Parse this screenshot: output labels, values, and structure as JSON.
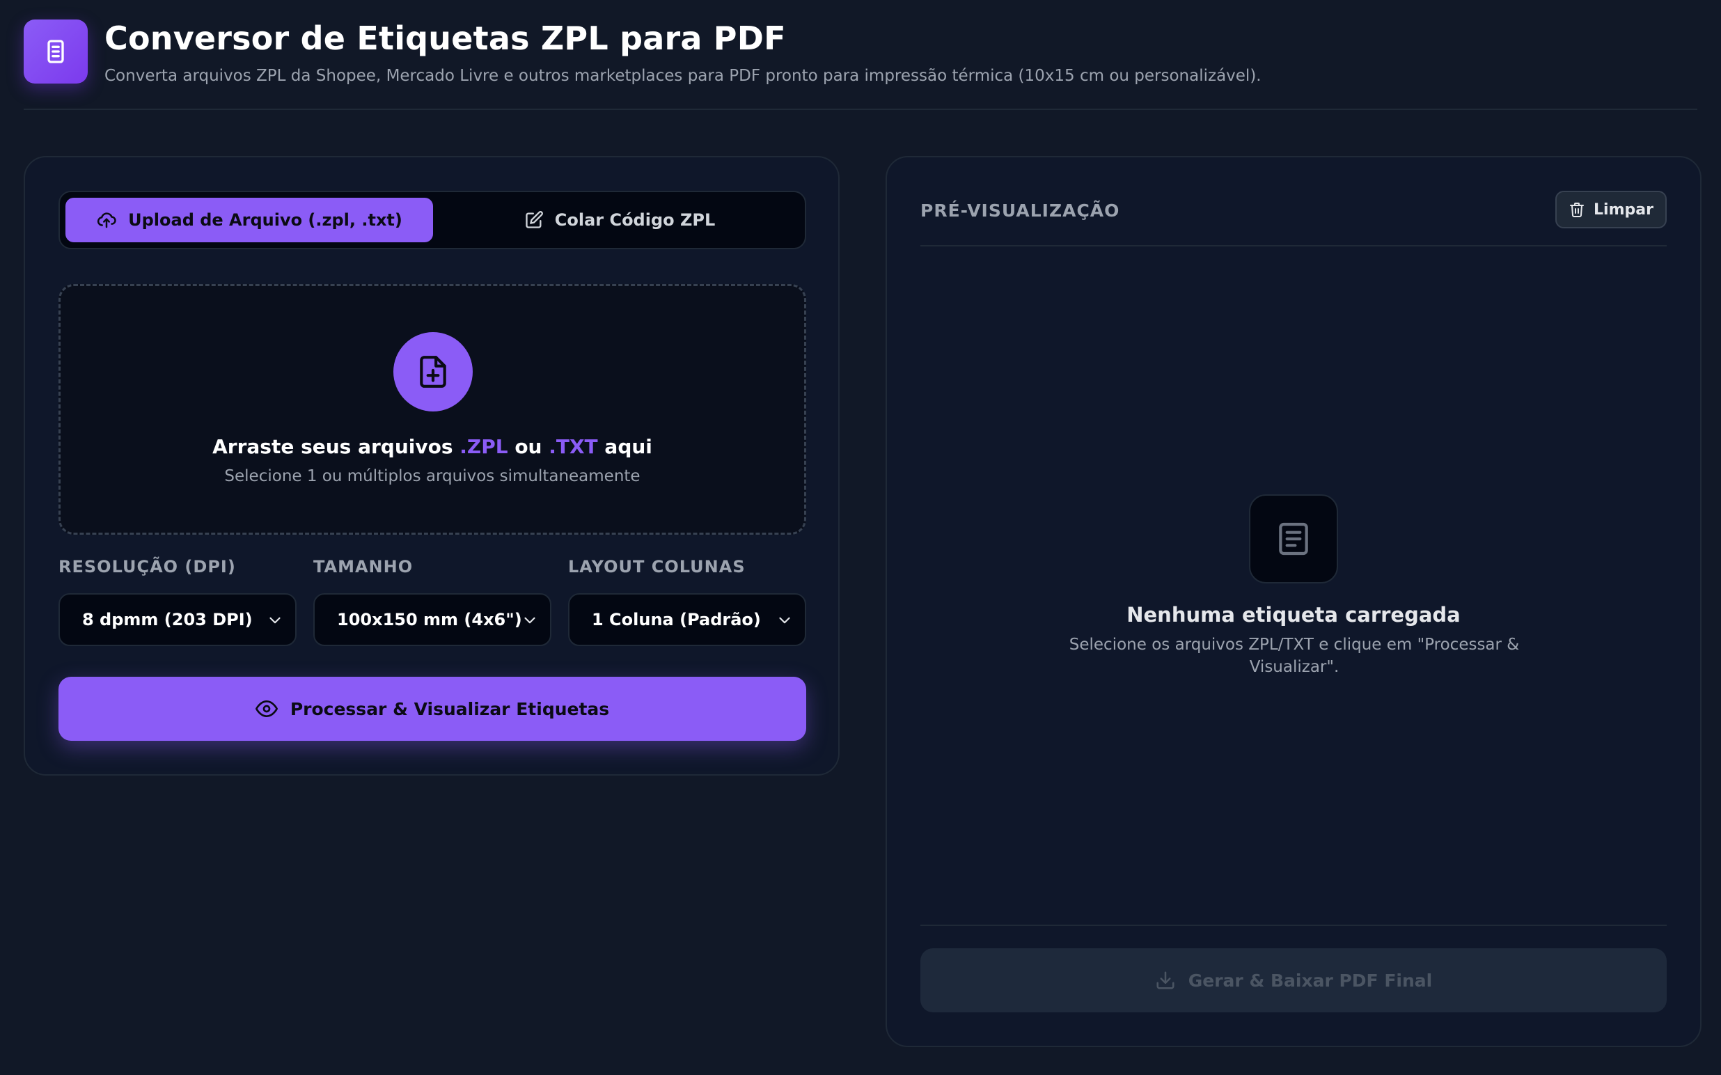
{
  "header": {
    "logo_icon": "document-icon",
    "title": "Conversor de Etiquetas ZPL para PDF",
    "subtitle": "Converta arquivos ZPL da Shopee, Mercado Livre e outros marketplaces para PDF pronto para impressão térmica (10x15 cm ou personalizável)."
  },
  "input_panel": {
    "tabs": [
      {
        "label": "Upload de Arquivo (.zpl, .txt)",
        "icon": "cloud-upload-icon",
        "active": true
      },
      {
        "label": "Colar Código ZPL",
        "icon": "edit-icon",
        "active": false
      }
    ],
    "dropzone": {
      "icon": "file-plus-icon",
      "title_prefix": "Arraste seus arquivos",
      "title_ext1": ".ZPL",
      "title_mid": "ou",
      "title_ext2": ".TXT",
      "title_suffix": "aqui",
      "subtitle": "Selecione 1 ou múltiplos arquivos simultaneamente"
    },
    "settings": {
      "resolution": {
        "label": "RESOLUÇÃO (DPI)",
        "value": "8 dpmm (203 DPI)"
      },
      "size": {
        "label": "TAMANHO",
        "value": "100x150 mm (4x6\")"
      },
      "layout": {
        "label": "LAYOUT COLUNAS",
        "value": "1 Coluna (Padrão)"
      }
    },
    "process_button": "Processar & Visualizar Etiquetas"
  },
  "preview_panel": {
    "title": "PRÉ-VISUALIZAÇÃO",
    "clear_button": "Limpar",
    "empty": {
      "icon": "document-icon",
      "title": "Nenhuma etiqueta carregada",
      "text": "Selecione os arquivos ZPL/TXT e clique em \"Processar & Visualizar\"."
    },
    "generate_button": "Gerar & Baixar PDF Final"
  },
  "colors": {
    "accent": "#8b5cf6",
    "background": "#111827",
    "panel": "#0f172a",
    "muted_text": "#9ca3af"
  }
}
